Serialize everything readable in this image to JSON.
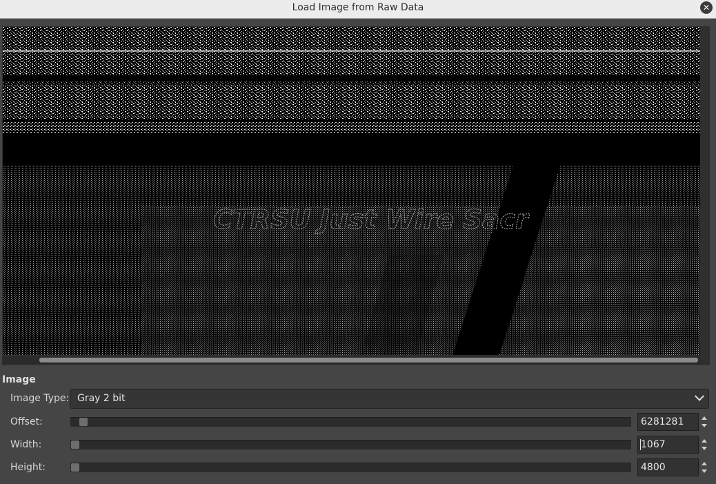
{
  "window": {
    "title": "Load Image from Raw Data",
    "close_icon": "close-icon"
  },
  "preview": {
    "overlay_text": "CTRSU Just Wire Sacr",
    "colors": {
      "background": "#000000",
      "pixels": "#ffffff"
    }
  },
  "image_section": {
    "heading": "Image",
    "image_type": {
      "label": "Image Type:",
      "value": "Gray 2 bit"
    },
    "offset": {
      "label": "Offset:",
      "value": "6281281",
      "slider_fraction": 0.02
    },
    "width": {
      "label": "Width:",
      "value": "1067",
      "slider_fraction": 0.0
    },
    "height": {
      "label": "Height:",
      "value": "4800",
      "slider_fraction": 0.0
    }
  }
}
